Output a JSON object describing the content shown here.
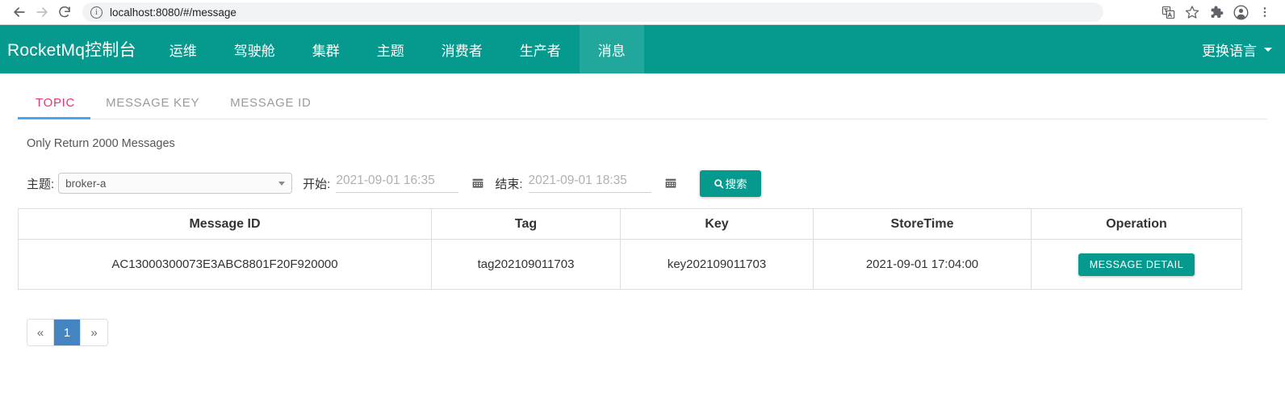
{
  "browser": {
    "back_icon": "arrow-left-icon",
    "forward_icon": "arrow-right-icon",
    "reload_icon": "reload-icon",
    "site_info_icon": "info-circle-icon",
    "url": "localhost:8080/#/message",
    "right_icons": [
      "translate-icon",
      "bookmark-star-icon",
      "extensions-puzzle-icon",
      "profile-avatar-icon",
      "three-dot-menu-icon"
    ]
  },
  "navbar": {
    "brand": "RocketMq控制台",
    "items": [
      {
        "label": "运维",
        "active": false
      },
      {
        "label": "驾驶舱",
        "active": false
      },
      {
        "label": "集群",
        "active": false
      },
      {
        "label": "主题",
        "active": false
      },
      {
        "label": "消费者",
        "active": false
      },
      {
        "label": "生产者",
        "active": false
      },
      {
        "label": "消息",
        "active": true
      }
    ],
    "language_label": "更换语言",
    "accent_color": "#069a8e",
    "active_color": "#21a79c"
  },
  "tabs": [
    {
      "label": "TOPIC",
      "active": true
    },
    {
      "label": "MESSAGE KEY",
      "active": false
    },
    {
      "label": "MESSAGE ID",
      "active": false
    }
  ],
  "tab_active_color": "#f0336a",
  "tab_indicator_color": "#3fa9f5",
  "notice": "Only Return 2000 Messages",
  "filters": {
    "topic_label": "主题:",
    "topic_value": "broker-a",
    "begin_label": "开始:",
    "begin_value": "2021-09-01 16:35",
    "end_label": "结束:",
    "end_value": "2021-09-01 18:35",
    "calendar_icon": "calendar-icon",
    "search_icon": "search-icon",
    "search_label": "搜索"
  },
  "table": {
    "headers": [
      "Message ID",
      "Tag",
      "Key",
      "StoreTime",
      "Operation"
    ],
    "rows": [
      {
        "message_id": "AC13000300073E3ABC8801F20F920000",
        "tag": "tag202109011703",
        "key": "key202109011703",
        "store_time": "2021-09-01 17:04:00",
        "action_label": "MESSAGE DETAIL"
      }
    ]
  },
  "pagination": {
    "prev": "«",
    "pages": [
      "1"
    ],
    "next": "»",
    "active_page": "1",
    "active_color": "#4484c0"
  }
}
